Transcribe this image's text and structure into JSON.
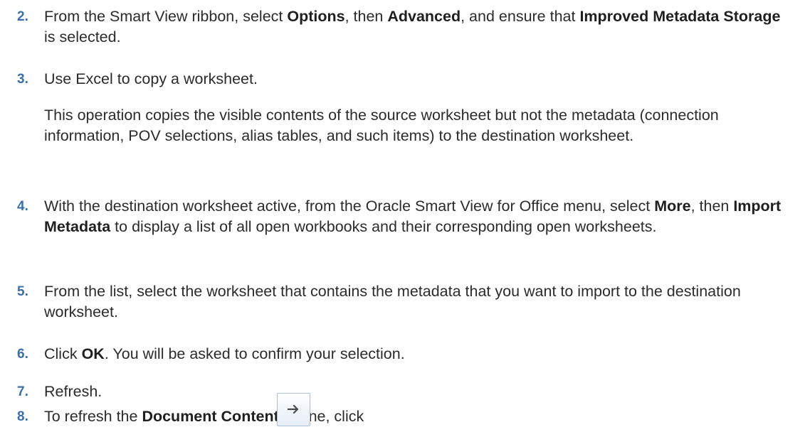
{
  "steps": [
    {
      "number": "2.",
      "parts": [
        {
          "t": "From the Smart View ribbon, select "
        },
        {
          "b": "Options"
        },
        {
          "t": ", then "
        },
        {
          "b": "Advanced"
        },
        {
          "t": ", and ensure that "
        },
        {
          "b": "Improved Metadata Storage"
        },
        {
          "t": " is selected."
        }
      ]
    },
    {
      "number": "3.",
      "parts": [
        {
          "t": "Use Excel to copy a worksheet."
        }
      ],
      "note": "This operation copies the visible contents of the source worksheet but not the metadata (connection information, POV selections, alias tables, and such items) to the destination worksheet."
    },
    {
      "number": "4.",
      "parts": [
        {
          "t": "With the destination worksheet active, from the Oracle Smart View for Office menu, select "
        },
        {
          "b": "More"
        },
        {
          "t": ", then "
        },
        {
          "b": "Import Metadata"
        },
        {
          "t": " to display a list of all open workbooks and their corresponding open worksheets."
        }
      ]
    },
    {
      "number": "5.",
      "parts": [
        {
          "t": "From the list, select the worksheet that contains the metadata that you want to import to the destination worksheet."
        }
      ]
    },
    {
      "number": "6.",
      "parts": [
        {
          "t": "Click "
        },
        {
          "b": "OK"
        },
        {
          "t": ". You will be asked to confirm your selection."
        }
      ]
    },
    {
      "number": "7.",
      "parts": [
        {
          "t": "Refresh."
        }
      ]
    },
    {
      "number": "8.",
      "parts": [
        {
          "t": "To refresh the "
        },
        {
          "b": "Document Contents"
        },
        {
          "t": " pane, click "
        }
      ],
      "icon": "refresh-arrow-icon"
    }
  ],
  "colors": {
    "step_number": "#3a6fa8",
    "text": "#2b2b2b",
    "button_border": "#a9bfd6"
  }
}
